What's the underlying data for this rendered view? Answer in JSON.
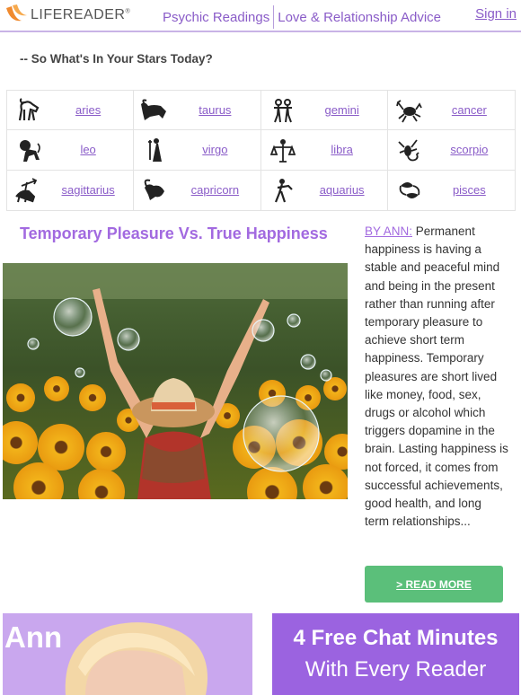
{
  "header": {
    "logo_text": "LIFEREADER",
    "logo_reg": "®",
    "nav": [
      "Psychic Readings",
      "Love & Relationship Advice"
    ],
    "signin": "Sign in"
  },
  "stars_heading": "-- So What's In Your Stars Today?",
  "zodiac": [
    {
      "label": "aries",
      "icon": "aries-icon"
    },
    {
      "label": "taurus",
      "icon": "taurus-icon"
    },
    {
      "label": "gemini",
      "icon": "gemini-icon"
    },
    {
      "label": "cancer",
      "icon": "cancer-icon"
    },
    {
      "label": "leo",
      "icon": "leo-icon"
    },
    {
      "label": "virgo",
      "icon": "virgo-icon"
    },
    {
      "label": "libra",
      "icon": "libra-icon"
    },
    {
      "label": "scorpio",
      "icon": "scorpio-icon"
    },
    {
      "label": "sagittarius",
      "icon": "sagittarius-icon"
    },
    {
      "label": "capricorn",
      "icon": "capricorn-icon"
    },
    {
      "label": "aquarius",
      "icon": "aquarius-icon"
    },
    {
      "label": "pisces",
      "icon": "pisces-icon"
    }
  ],
  "article": {
    "title": "Temporary Pleasure Vs. True Happiness",
    "byline": "BY ANN:",
    "body": " Permanent happiness is having a stable and peaceful mind and being in the present rather than running after temporary pleasure to achieve short term happiness. Temporary pleasures are short lived like money, food, sex, drugs or alcohol which triggers dopamine in the brain. Lasting happiness is not forced, it comes from successful achievements, good health, and long term relationships...",
    "read_more": "> READ MORE"
  },
  "banners": {
    "ann_name": "Ann",
    "chat_line1": "4 Free Chat Minutes",
    "chat_line2": "With Every Reader"
  },
  "colors": {
    "accent_purple": "#8a5cc8",
    "title_purple": "#a26ae0",
    "button_green": "#5bbf7a",
    "banner_purple": "#9b63e0"
  }
}
